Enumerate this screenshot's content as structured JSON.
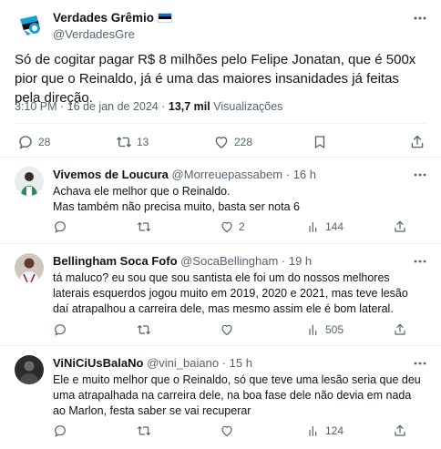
{
  "main_tweet": {
    "author_name": "Verdades Grêmio",
    "author_handle": "@VerdadesGre",
    "text": "Só de cogitar pagar R$ 8 milhões pelo Felipe Jonatan, que é 500x pior que o Reinaldo, já é uma das maiores insanidades já feitas pela direção.",
    "time": "3:10 PM · 16 de jan de 2024 ·",
    "views_count": "13,7 mil",
    "views_label": "Visualizações",
    "stats": {
      "replies": "28",
      "reposts": "13",
      "likes": "228"
    }
  },
  "replies": [
    {
      "name": "Vivemos de Loucura",
      "handle": "@Morreuepassabem",
      "time": "· 16 h",
      "text_line1": "Achava ele melhor que o Reinaldo.",
      "text_line2": "Mas também não precisa muito, basta ser nota 6",
      "likes": "2",
      "views": "144"
    },
    {
      "name": "Bellingham Soca Fofo",
      "handle": "@SocaBellingham",
      "time": "· 19 h",
      "text": "tá maluco? eu sou que sou santista ele foi um do nossos melhores laterais esquerdos jogou muito em 2019, 2020 e 2021, mas teve lesão daí atrapalhou a carreira dele, mas mesmo assim ele é bom lateral.",
      "views": "505"
    },
    {
      "name": "ViNiCiUsBalaNo",
      "handle": "@vini_baiano",
      "time": "· 15 h",
      "text": "Ele e muito melhor que o Reinaldo, só que teve uma lesão seria que deu uma atrapalhada na carreira dele, na boa fase dele não devia em nada ao Marlon, festa saber se vai recuperar",
      "views": "124"
    }
  ],
  "colors": {
    "text_primary": "#0f1419",
    "text_secondary": "#536471",
    "divider": "#eff3f4",
    "gremio_blue": "#1a9fd8"
  },
  "icons": [
    "more-icon",
    "reply-icon",
    "repost-icon",
    "like-icon",
    "bookmark-icon",
    "share-icon",
    "views-icon"
  ]
}
